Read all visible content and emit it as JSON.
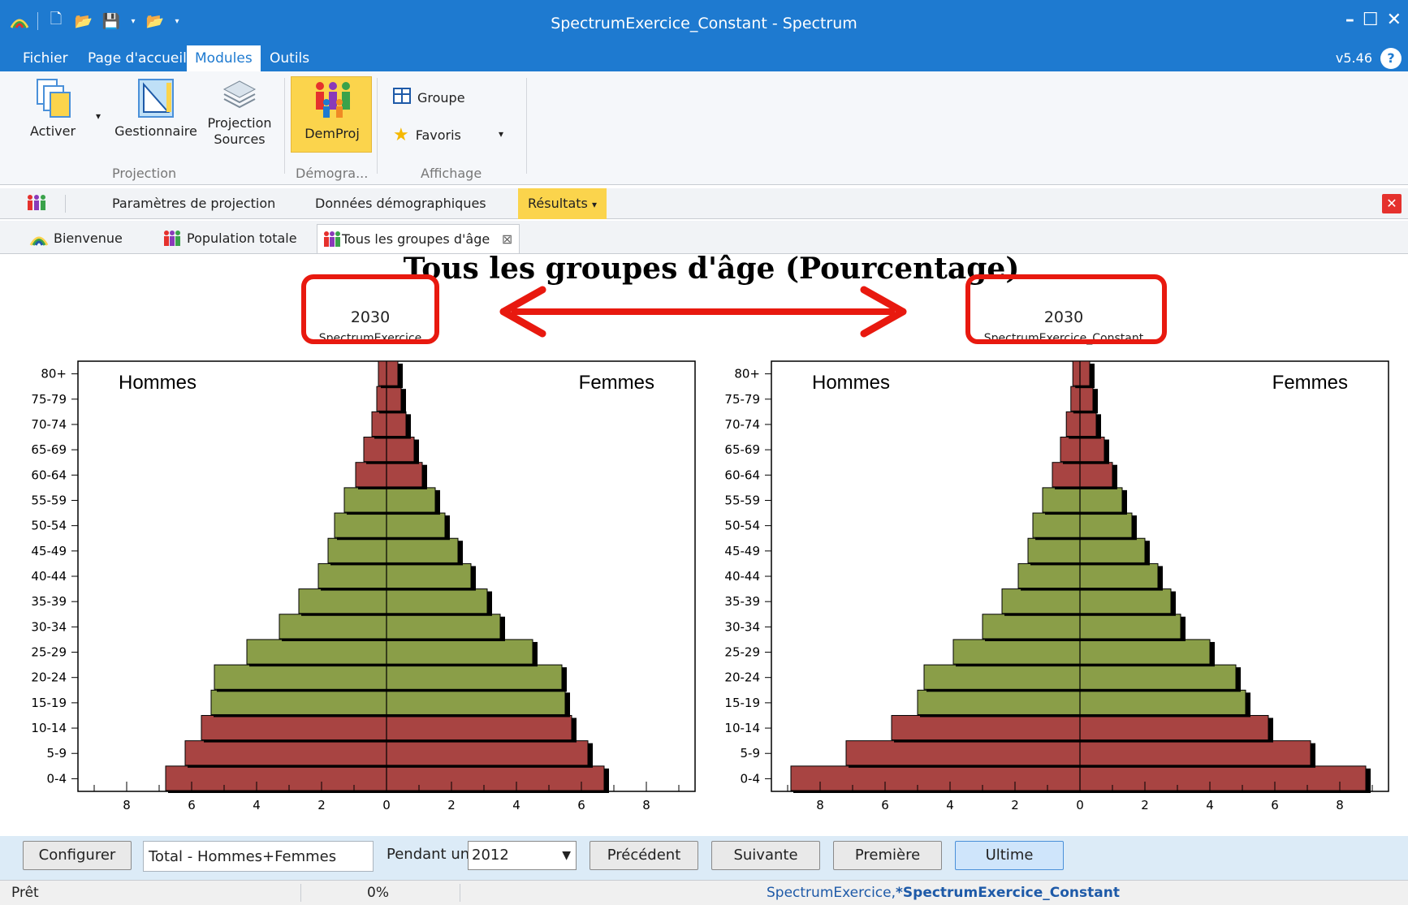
{
  "window": {
    "title": "SpectrumExercice_Constant - Spectrum"
  },
  "menu": {
    "items": [
      "Fichier",
      "Page d'accueil",
      "Modules",
      "Outils"
    ],
    "active": "Modules",
    "version": "v5.46"
  },
  "ribbon": {
    "activer": "Activer",
    "gestionnaire": "Gestionnaire",
    "projection_sources": "Projection\nSources",
    "demproj": "DemProj",
    "groupe": "Groupe",
    "favoris": "Favoris",
    "group_projection": "Projection",
    "group_demogra": "Démogra...",
    "group_affichage": "Affichage"
  },
  "subtoolbar": {
    "params": "Paramètres de projection",
    "donnees": "Données démographiques",
    "resultats": "Résultats"
  },
  "tabs": {
    "bienvenue": "Bienvenue",
    "population": "Population totale",
    "groupes": "Tous les groupes d'âge"
  },
  "chart_data": {
    "type": "bar",
    "title": "Tous les groupes d'âge (Pourcentage)",
    "categories": [
      "0-4",
      "5-9",
      "10-14",
      "15-19",
      "20-24",
      "25-29",
      "30-34",
      "35-39",
      "40-44",
      "45-49",
      "50-54",
      "55-59",
      "60-64",
      "65-69",
      "70-74",
      "75-79",
      "80+"
    ],
    "colors": {
      "outer": "#a84442",
      "working": "#8a9e48",
      "shadow": "#000000"
    },
    "xlim": [
      -9.5,
      9.5
    ],
    "xticks": [
      8,
      6,
      4,
      2,
      0,
      2,
      4,
      6,
      8
    ],
    "panels": [
      {
        "year": "2030",
        "subtitle": "SpectrumExercice",
        "left_label": "Hommes",
        "right_label": "Femmes",
        "men": [
          6.8,
          6.2,
          5.7,
          5.4,
          5.3,
          4.3,
          3.3,
          2.7,
          2.1,
          1.8,
          1.6,
          1.3,
          0.95,
          0.7,
          0.45,
          0.3,
          0.25
        ],
        "women": [
          6.7,
          6.2,
          5.7,
          5.5,
          5.4,
          4.5,
          3.5,
          3.1,
          2.6,
          2.2,
          1.8,
          1.5,
          1.1,
          0.85,
          0.6,
          0.45,
          0.35
        ]
      },
      {
        "year": "2030",
        "subtitle": "SpectrumExercice_Constant",
        "left_label": "Hommes",
        "right_label": "Femmes",
        "men": [
          8.9,
          7.2,
          5.8,
          5.0,
          4.8,
          3.9,
          3.0,
          2.4,
          1.9,
          1.6,
          1.45,
          1.15,
          0.85,
          0.6,
          0.42,
          0.28,
          0.22
        ],
        "women": [
          8.8,
          7.1,
          5.8,
          5.1,
          4.8,
          4.0,
          3.1,
          2.8,
          2.4,
          2.0,
          1.6,
          1.3,
          1.0,
          0.75,
          0.5,
          0.4,
          0.3
        ]
      }
    ]
  },
  "bottom": {
    "configurer": "Configurer",
    "total": "Total - Hommes+Femmes",
    "pendant": "Pendant un",
    "year": "2012",
    "precedent": "Précédent",
    "suivante": "Suivante",
    "premiere": "Première",
    "ultime": "Ultime"
  },
  "status": {
    "ready": "Prêt",
    "progress": "0%",
    "projection1": "SpectrumExercice,",
    "projection2": "*SpectrumExercice_Constant"
  }
}
